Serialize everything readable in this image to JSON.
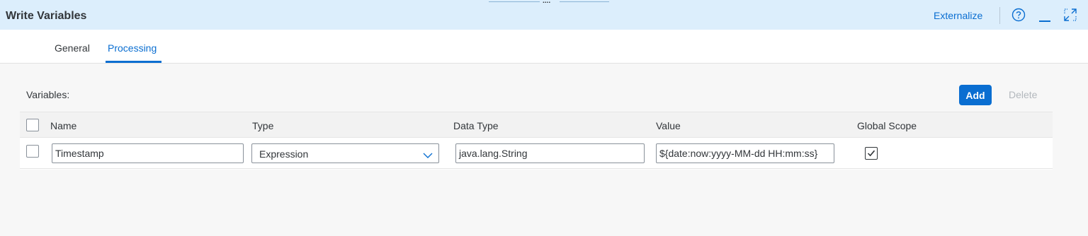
{
  "dialog": {
    "title": "Write Variables",
    "externalize_label": "Externalize",
    "drag_handle_text": "....",
    "icons": {
      "help": "help-icon",
      "minimize": "minimize-icon",
      "expand": "expand-icon"
    }
  },
  "tabs": [
    {
      "label": "General",
      "active": false
    },
    {
      "label": "Processing",
      "active": true
    }
  ],
  "variables_section": {
    "label": "Variables:",
    "add_label": "Add",
    "delete_label": "Delete",
    "columns": [
      "Name",
      "Type",
      "Data Type",
      "Value",
      "Global Scope"
    ],
    "rows": [
      {
        "selected": false,
        "name": "Timestamp",
        "type": "Expression",
        "data_type": "java.lang.String",
        "value": "${date:now:yyyy-MM-dd HH:mm:ss}",
        "global_scope": true
      }
    ]
  },
  "colors": {
    "accent": "#0a6ed1",
    "header_bg": "#dceefc",
    "disabled_text": "#b3b8bd"
  }
}
